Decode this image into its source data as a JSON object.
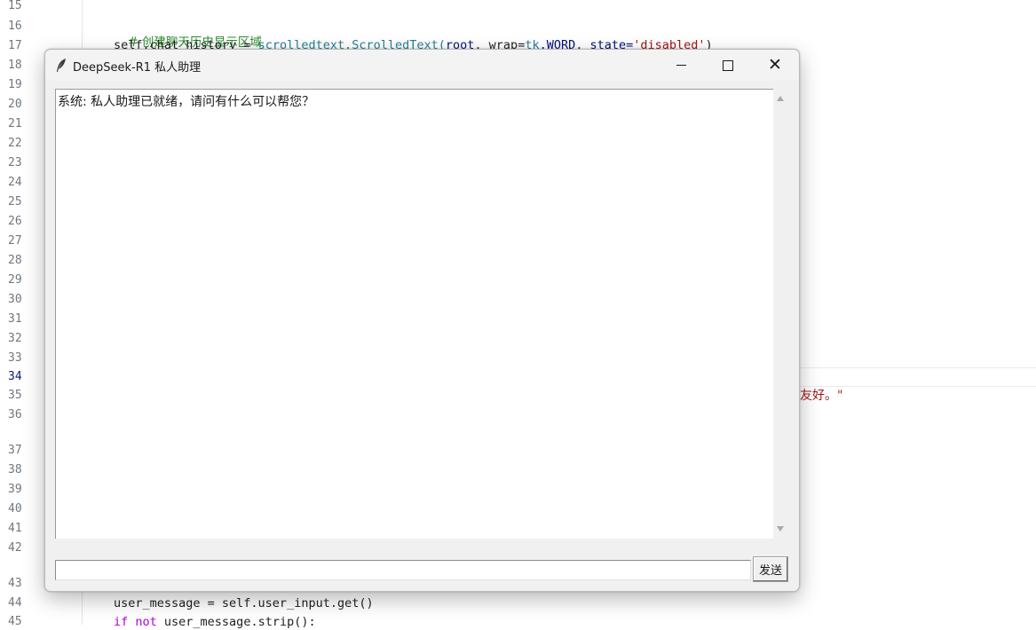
{
  "editor": {
    "line_numbers": [
      "15",
      "16",
      "17",
      "18",
      "19",
      "20",
      "21",
      "22",
      "23",
      "24",
      "25",
      "26",
      "27",
      "28",
      "29",
      "30",
      "31",
      "32",
      "33",
      "34",
      "35",
      "36",
      "37",
      "38",
      "39",
      "40",
      "41",
      "42",
      "43",
      "44",
      "45"
    ],
    "active_line": "34",
    "code": {
      "line16_comment": "# 创建聊天历史显示区域",
      "line17_self": "self",
      "line17_chat": ".chat_history = ",
      "line17_module": "scrolledtext",
      "line17_cls": ".ScrolledText(",
      "line17_root": "root",
      "line17_wrap": ", wrap=",
      "line17_tk": "tk",
      "line17_word": ".WORD, state=",
      "line17_str": "'disabled'",
      "line17_end": ")",
      "line35_tail": "友好。\"",
      "line44": "user_message = self.user_input.get()",
      "line45_kw": "if not",
      "line45_rest": " user_message.strip():"
    }
  },
  "window": {
    "icon": "tk-feather-icon",
    "title": "DeepSeek-R1 私人助理",
    "chat_text": "系统: 私人助理已就绪，请问有什么可以帮您？",
    "input_value": "",
    "send_label": "发送"
  }
}
